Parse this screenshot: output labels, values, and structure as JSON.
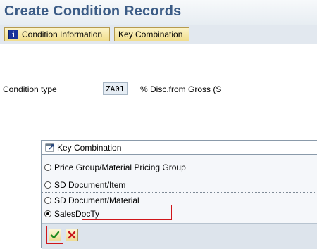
{
  "header": {
    "title": "Create Condition Records"
  },
  "toolbar": {
    "condition_information": "Condition Information",
    "key_combination": "Key Combination"
  },
  "condition": {
    "label": "Condition type",
    "value": "ZA01",
    "description": "% Disc.from Gross (S"
  },
  "dialog": {
    "title": "Key Combination",
    "options": [
      {
        "label": "Price Group/Material Pricing Group",
        "selected": false
      },
      {
        "label": "SD Document/Item",
        "selected": false
      },
      {
        "label": "SD Document/Material",
        "selected": false
      },
      {
        "label": "SalesDocTy",
        "selected": true
      }
    ]
  },
  "colors": {
    "title_text": "#3c5c86",
    "toolbar_button": "#f1de8c",
    "highlight": "#d0161a"
  },
  "icons": {
    "info": "info-icon",
    "dialog": "dialog-window-icon",
    "confirm": "checkmark-icon",
    "cancel": "cancel-x-icon"
  }
}
